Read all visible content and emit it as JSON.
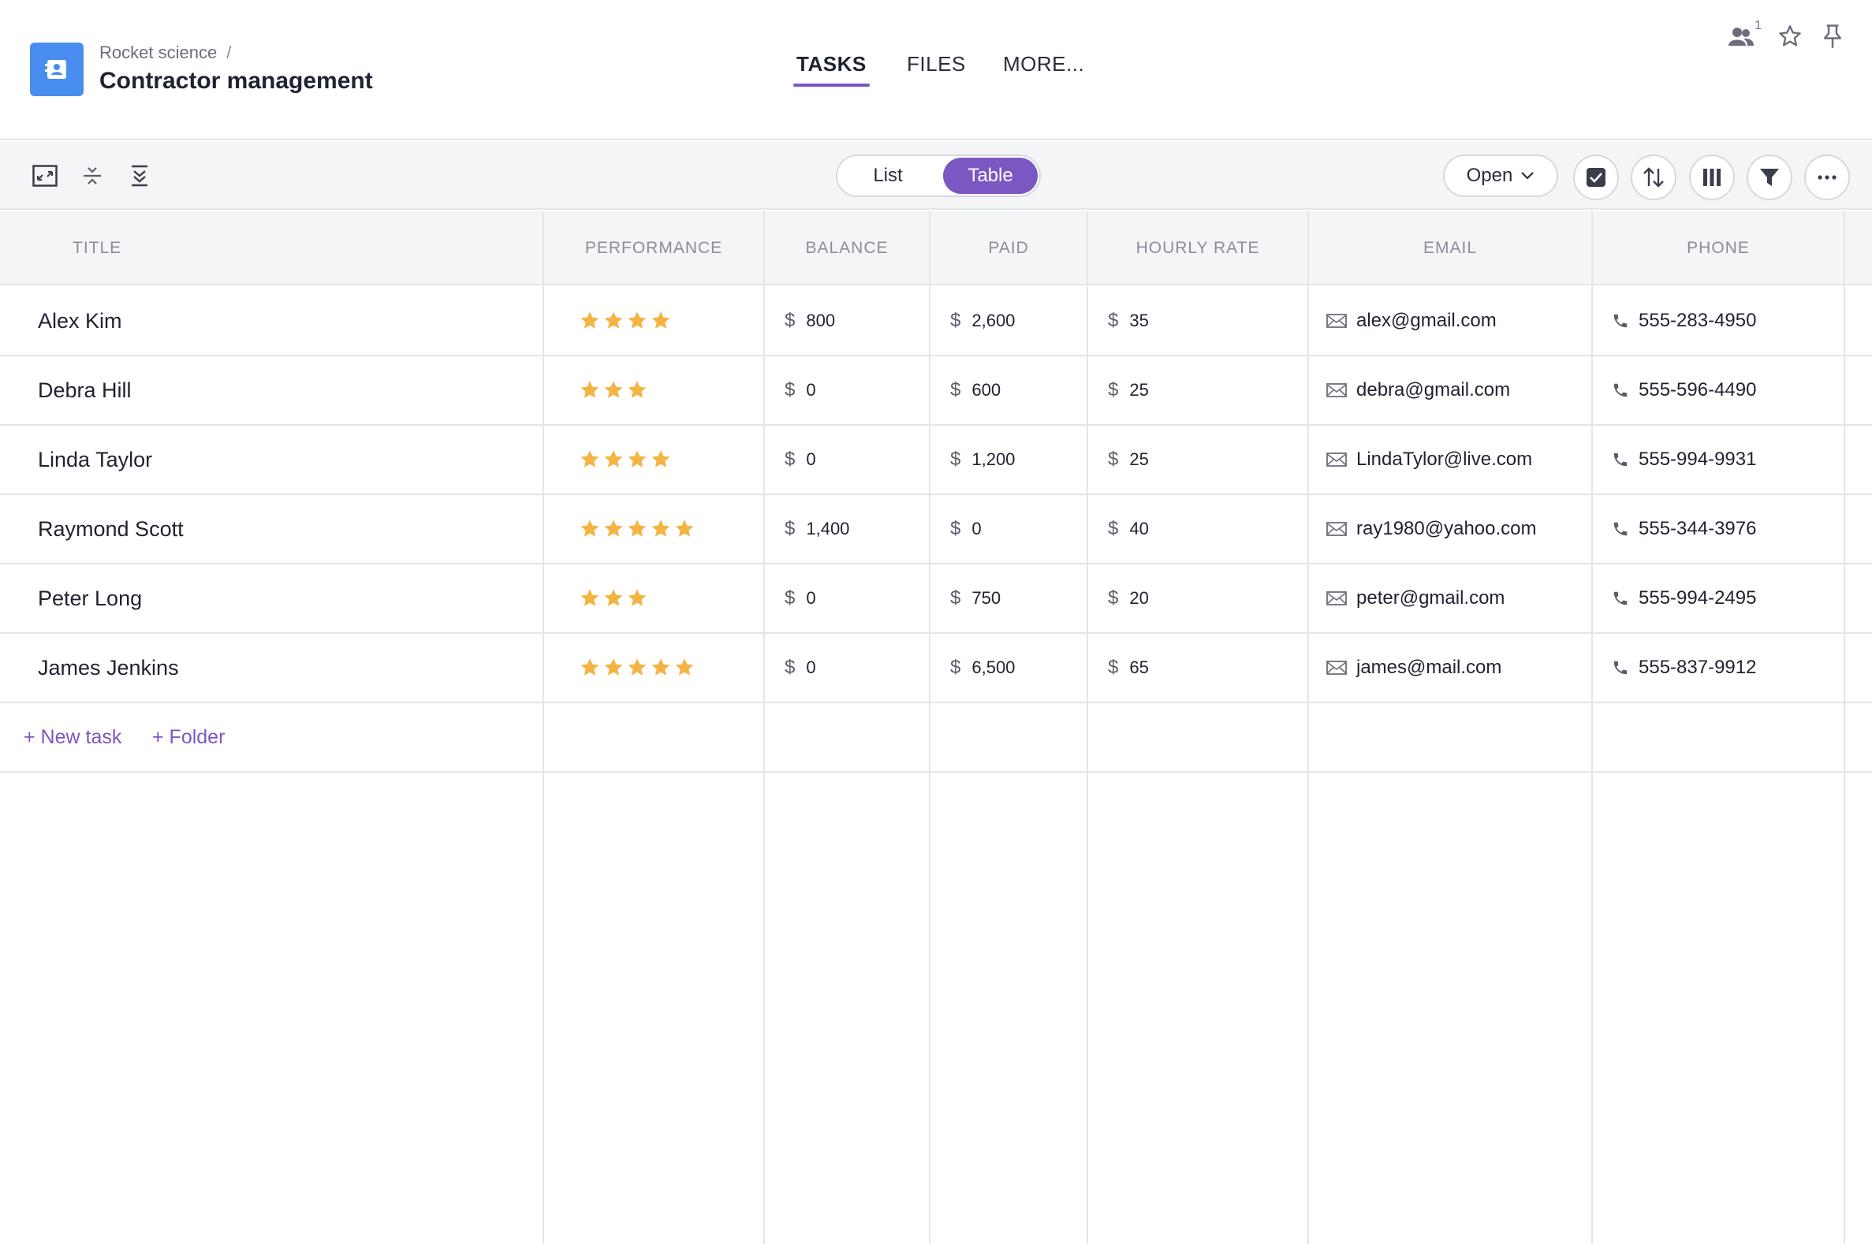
{
  "header": {
    "breadcrumb": "Rocket science",
    "breadcrumb_sep": "/",
    "title": "Contractor management",
    "tabs": [
      {
        "label": "TASKS",
        "active": true
      },
      {
        "label": "FILES",
        "active": false
      },
      {
        "label": "MORE..."
      }
    ],
    "members_count": "1"
  },
  "toolbar": {
    "view_list": "List",
    "view_table": "Table",
    "status_filter": "Open",
    "accent_color": "#7b57c4"
  },
  "columns": [
    "TITLE",
    "PERFORMANCE",
    "BALANCE",
    "PAID",
    "HOURLY RATE",
    "EMAIL",
    "PHONE"
  ],
  "currency_symbol": "$",
  "rows": [
    {
      "title": "Alex Kim",
      "rating": 4,
      "balance": "800",
      "paid": "2,600",
      "rate": "35",
      "email": "alex@gmail.com",
      "phone": "555-283-4950"
    },
    {
      "title": "Debra Hill",
      "rating": 3,
      "balance": "0",
      "paid": "600",
      "rate": "25",
      "email": "debra@gmail.com",
      "phone": "555-596-4490"
    },
    {
      "title": "Linda Taylor",
      "rating": 4,
      "balance": "0",
      "paid": "1,200",
      "rate": "25",
      "email": "LindaTylor@live.com",
      "phone": "555-994-9931"
    },
    {
      "title": "Raymond Scott",
      "rating": 5,
      "balance": "1,400",
      "paid": "0",
      "rate": "40",
      "email": "ray1980@yahoo.com",
      "phone": "555-344-3976"
    },
    {
      "title": "Peter Long",
      "rating": 3,
      "balance": "0",
      "paid": "750",
      "rate": "20",
      "email": "peter@gmail.com",
      "phone": "555-994-2495"
    },
    {
      "title": "James Jenkins",
      "rating": 5,
      "balance": "0",
      "paid": "6,500",
      "rate": "65",
      "email": "james@mail.com",
      "phone": "555-837-9912"
    }
  ],
  "add_actions": {
    "new_task": "+ New task",
    "folder": "+ Folder"
  },
  "star_color": "#f3b443"
}
